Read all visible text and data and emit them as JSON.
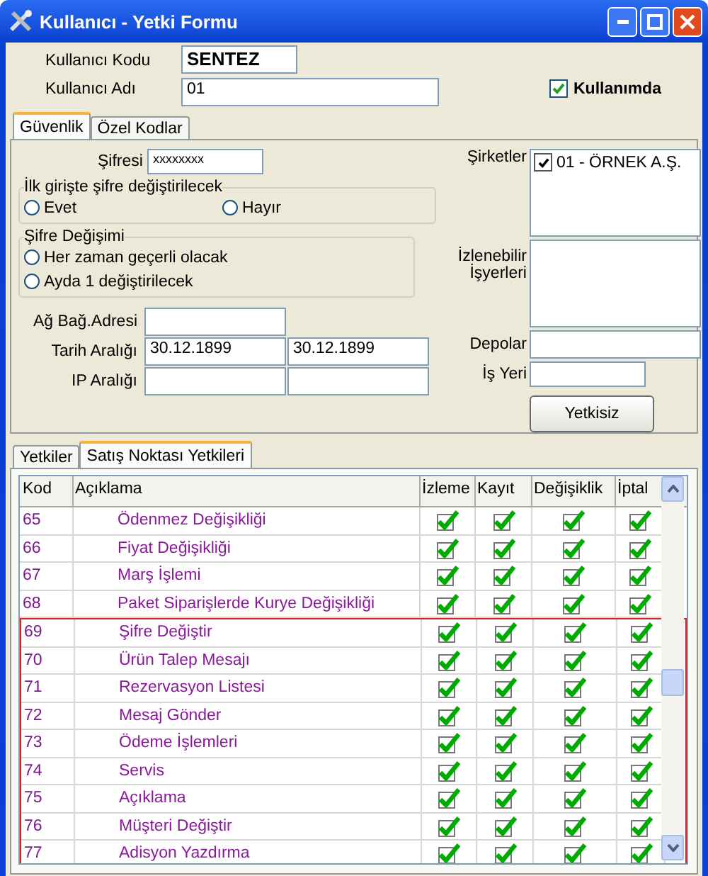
{
  "window": {
    "title": "Kullanıcı - Yetki Formu"
  },
  "header": {
    "code_label": "Kullanıcı Kodu",
    "code_value": "SENTEZ",
    "name_label": "Kullanıcı Adı",
    "name_value": "01",
    "active_label": "Kullanımda",
    "active_checked": true
  },
  "top_tabs": [
    {
      "label": "Güvenlik",
      "selected": true
    },
    {
      "label": "Özel Kodlar",
      "selected": false
    }
  ],
  "security": {
    "password_label": "Şifresi",
    "password_value": "xxxxxxxx",
    "first_login_group": {
      "title": "İlk girişte şifre değiştirilecek",
      "options": [
        {
          "label": "Evet",
          "selected": false
        },
        {
          "label": "Hayır",
          "selected": false
        }
      ]
    },
    "change_group": {
      "title": "Şifre Değişimi",
      "options": [
        {
          "label": "Her zaman geçerli olacak",
          "selected": false
        },
        {
          "label": "Ayda 1 değiştirilecek",
          "selected": false
        }
      ]
    },
    "network_label": "Ağ Bağ.Adresi",
    "date_label": "Tarih Aralığı",
    "date_from": "30.12.1899",
    "date_to": "30.12.1899",
    "ip_label": "IP Aralığı",
    "companies_label": "Şirketler",
    "companies": [
      {
        "label": "01 - ÖRNEK A.Ş.",
        "checked": true
      }
    ],
    "workplaces_label_1": "İzlenebilir",
    "workplaces_label_2": "İşyerleri",
    "depots_label": "Depolar",
    "workplace_label": "İş Yeri",
    "unauthorized_button": "Yetkisiz"
  },
  "bottom_tabs": [
    {
      "label": "Yetkiler",
      "selected": false
    },
    {
      "label": "Satış Noktası Yetkileri",
      "selected": true
    }
  ],
  "table": {
    "columns": [
      "Kod",
      "Açıklama",
      "İzleme",
      "Kayıt",
      "Değişiklik",
      "İptal"
    ],
    "rows": [
      {
        "code": "65",
        "description": "Ödenmez Değişikliği",
        "view": true,
        "save": true,
        "change": true,
        "cancel": true
      },
      {
        "code": "66",
        "description": "Fiyat Değişikliği",
        "view": true,
        "save": true,
        "change": true,
        "cancel": true
      },
      {
        "code": "67",
        "description": "Marş İşlemi",
        "view": true,
        "save": true,
        "change": true,
        "cancel": true
      },
      {
        "code": "68",
        "description": "Paket Siparişlerde Kurye Değişikliği",
        "view": true,
        "save": true,
        "change": true,
        "cancel": true
      }
    ],
    "highlighted_rows": [
      {
        "code": "69",
        "description": "Şifre Değiştir",
        "view": true,
        "save": true,
        "change": true,
        "cancel": true
      },
      {
        "code": "70",
        "description": "Ürün Talep Mesajı",
        "view": true,
        "save": true,
        "change": true,
        "cancel": true
      },
      {
        "code": "71",
        "description": "Rezervasyon Listesi",
        "view": true,
        "save": true,
        "change": true,
        "cancel": true
      },
      {
        "code": "72",
        "description": "Mesaj Gönder",
        "view": true,
        "save": true,
        "change": true,
        "cancel": true
      },
      {
        "code": "73",
        "description": "Ödeme İşlemleri",
        "view": true,
        "save": true,
        "change": true,
        "cancel": true
      },
      {
        "code": "74",
        "description": "Servis",
        "view": true,
        "save": true,
        "change": true,
        "cancel": true
      },
      {
        "code": "75",
        "description": "Açıklama",
        "view": true,
        "save": true,
        "change": true,
        "cancel": true
      },
      {
        "code": "76",
        "description": "Müşteri Değiştir",
        "view": true,
        "save": true,
        "change": true,
        "cancel": true
      },
      {
        "code": "77",
        "description": "Adisyon Yazdırma",
        "view": true,
        "save": true,
        "change": true,
        "cancel": true
      }
    ]
  }
}
